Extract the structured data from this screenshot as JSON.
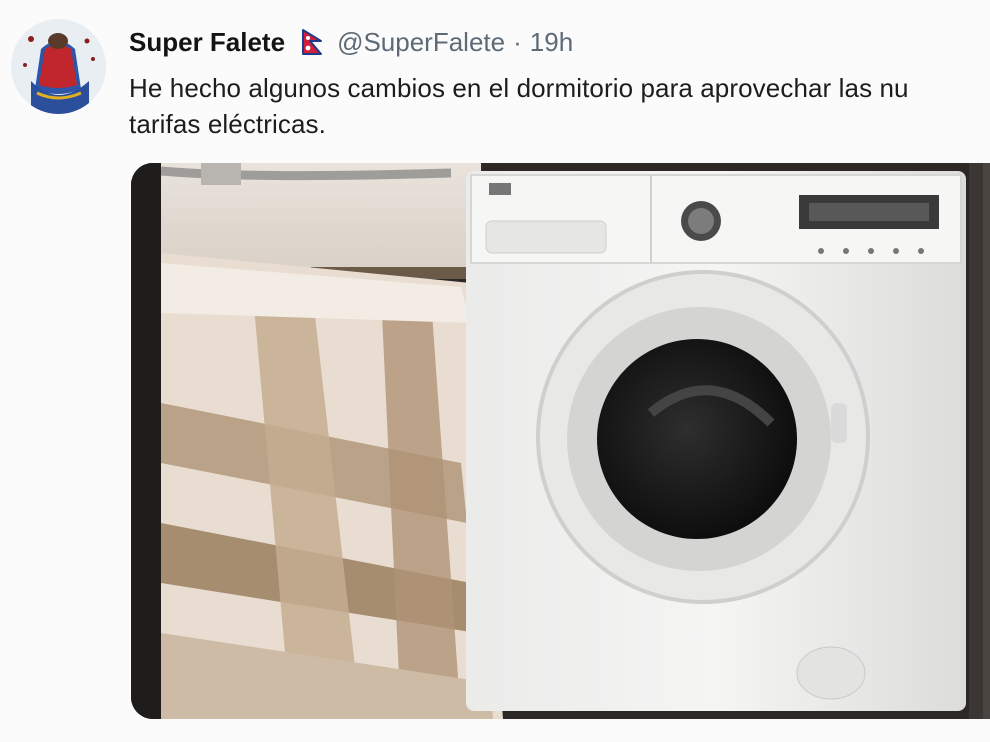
{
  "tweet": {
    "display_name": "Super Falete",
    "handle": "@SuperFalete",
    "separator": "·",
    "time": "19h",
    "text_line_1": "He hecho algunos cambios en el dormitorio para aprovechar las nu",
    "text_line_2": "tarifas eléctricas.",
    "avatar_icon": "superhero-avatar",
    "flag_icon": "nepal-flag-icon",
    "media_description_icon": "photo-bed-and-washing-machine"
  },
  "colors": {
    "name": "#141414",
    "secondary": "#5e6b77",
    "text": "#1d1d1d",
    "background": "#fbfbfb"
  }
}
